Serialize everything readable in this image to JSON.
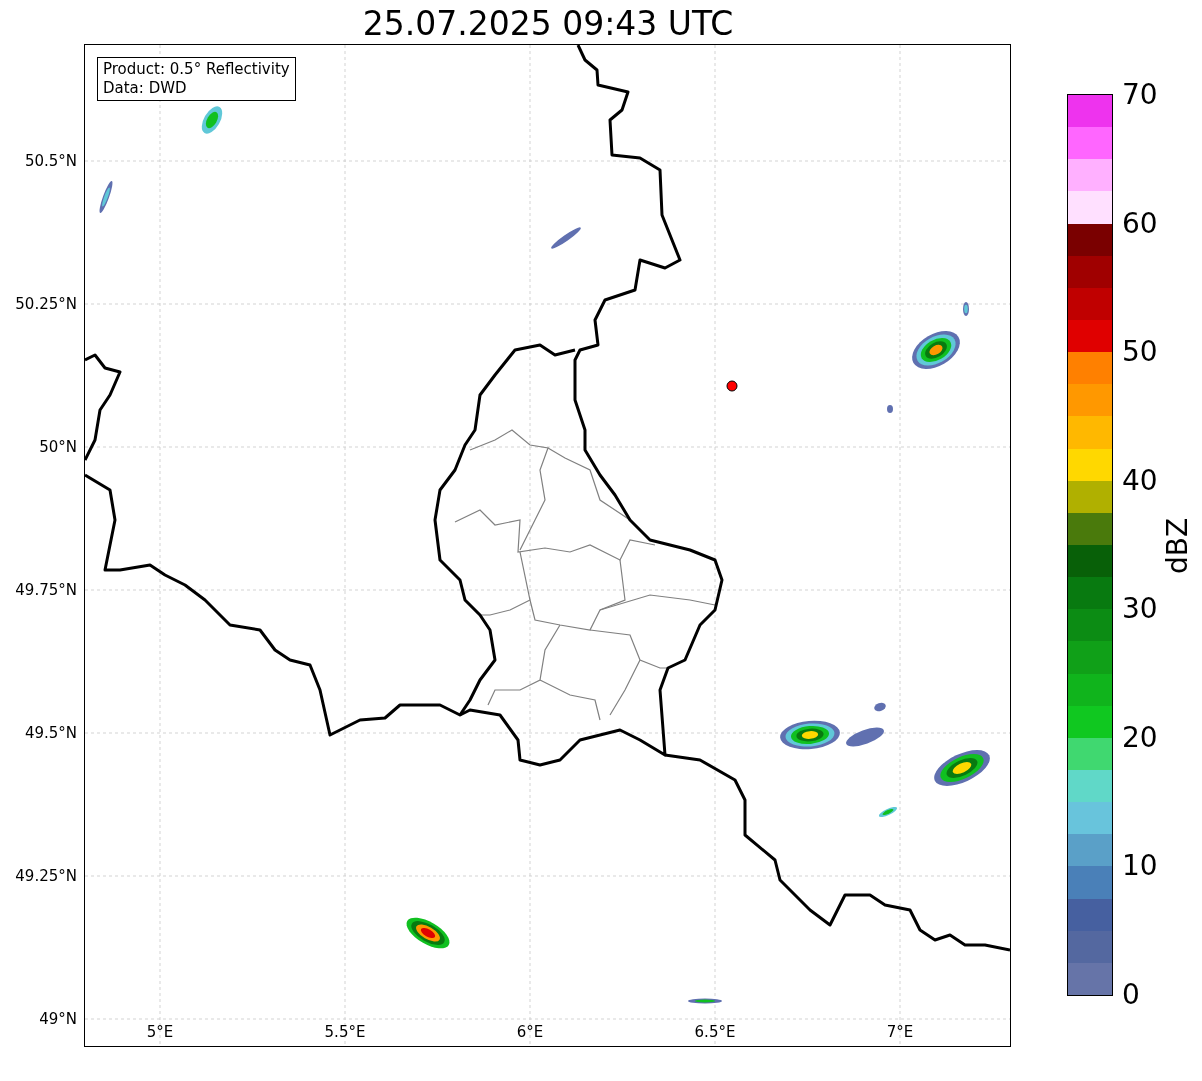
{
  "title": "25.07.2025 09:43 UTC",
  "legend": [
    "Product: 0.5° Reflectivity",
    "Data: DWD"
  ],
  "map": {
    "x_ticks": [
      "5°E",
      "5.5°E",
      "6°E",
      "6.5°E",
      "7°E"
    ],
    "y_ticks": [
      "50.5°N",
      "50.25°N",
      "50°N",
      "49.75°N",
      "49.5°N",
      "49.25°N",
      "49°N"
    ]
  },
  "colorbar": {
    "label": "dBZ",
    "ticks": [
      "70",
      "60",
      "50",
      "40",
      "30",
      "20",
      "10",
      "0"
    ],
    "bands": [
      {
        "color": "#ee33ee"
      },
      {
        "color": "#ff66ff"
      },
      {
        "color": "#ffb0ff"
      },
      {
        "color": "#ffe0ff"
      },
      {
        "color": "#7a0000"
      },
      {
        "color": "#a00000"
      },
      {
        "color": "#c00000"
      },
      {
        "color": "#e00000"
      },
      {
        "color": "#ff8000"
      },
      {
        "color": "#ff9800"
      },
      {
        "color": "#ffb800"
      },
      {
        "color": "#ffd800"
      },
      {
        "color": "#b0b000"
      },
      {
        "color": "#4a7a0c"
      },
      {
        "color": "#086008"
      },
      {
        "color": "#087a10"
      },
      {
        "color": "#0c8c14"
      },
      {
        "color": "#10a018"
      },
      {
        "color": "#10b41c"
      },
      {
        "color": "#10c820"
      },
      {
        "color": "#40d870"
      },
      {
        "color": "#60d8c8"
      },
      {
        "color": "#68c4dc"
      },
      {
        "color": "#5aa0c8"
      },
      {
        "color": "#4a80b8"
      },
      {
        "color": "#4660a0"
      },
      {
        "color": "#5468a0"
      },
      {
        "color": "#6674a8"
      }
    ]
  }
}
